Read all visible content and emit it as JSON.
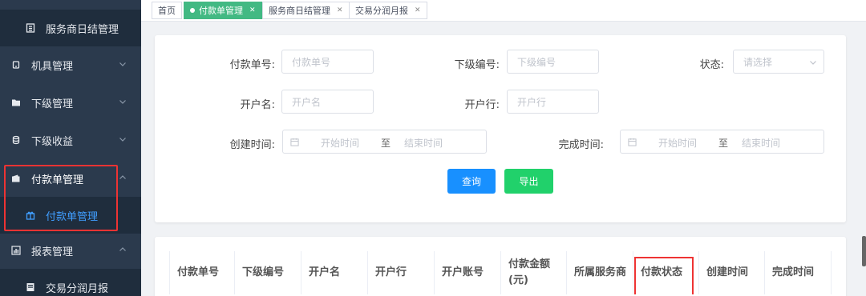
{
  "sidebar": {
    "items": [
      {
        "label": "服务商日结管理",
        "icon": "list-icon"
      },
      {
        "label": "机具管理",
        "icon": "device-icon"
      },
      {
        "label": "下级管理",
        "icon": "folder-icon"
      },
      {
        "label": "下级收益",
        "icon": "coins-icon"
      },
      {
        "label": "付款单管理",
        "icon": "wallet-icon"
      },
      {
        "label": "付款单管理",
        "icon": "gift-icon"
      },
      {
        "label": "报表管理",
        "icon": "chart-icon"
      },
      {
        "label": "交易分润月报",
        "icon": "report-icon"
      }
    ]
  },
  "tabs": [
    {
      "label": "首页"
    },
    {
      "label": "付款单管理"
    },
    {
      "label": "服务商日结管理"
    },
    {
      "label": "交易分润月报"
    }
  ],
  "filters": {
    "order_no_label": "付款单号:",
    "order_no_placeholder": "付款单号",
    "sub_no_label": "下级编号:",
    "sub_no_placeholder": "下级编号",
    "status_label": "状态:",
    "status_placeholder": "请选择",
    "account_name_label": "开户名:",
    "account_name_placeholder": "开户名",
    "bank_label": "开户行:",
    "bank_placeholder": "开户行",
    "created_label": "创建时间:",
    "finished_label": "完成时间:",
    "start_placeholder": "开始时间",
    "range_sep": "至",
    "end_placeholder": "结束时间"
  },
  "buttons": {
    "query": "查询",
    "export": "导出"
  },
  "colors": {
    "sidebar_bg": "#2b3a4d",
    "active_tab": "#42b983",
    "query_button": "#1890ff",
    "export_button": "#21d16b",
    "highlight": "#e33333"
  },
  "table": {
    "columns": [
      "付款单号",
      "下级编号",
      "开户名",
      "开户行",
      "开户账号",
      "付款金额(元)",
      "所属服务商",
      "付款状态",
      "创建时间",
      "完成时间"
    ]
  }
}
